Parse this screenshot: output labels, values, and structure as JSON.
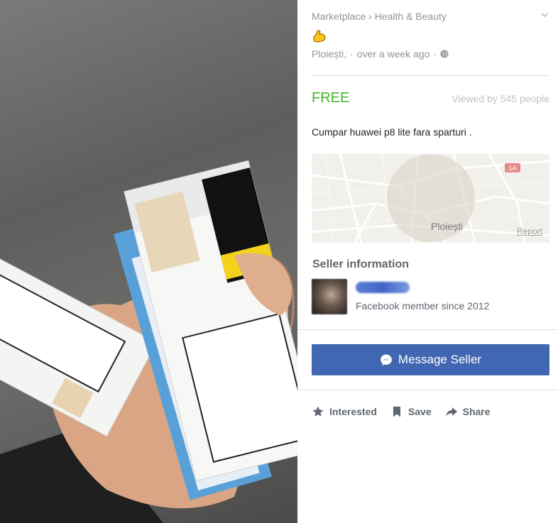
{
  "listing": {
    "breadcrumb": {
      "root": "Marketplace",
      "separator": "›",
      "category": "Health & Beauty"
    },
    "title_icon": "flexed-biceps-emoji",
    "location": "Ploiești,",
    "meta_separator": "·",
    "time_posted": "over a week ago",
    "privacy_icon": "globe-icon",
    "price": "FREE",
    "views": "Viewed by 545 people",
    "description": "Cumpar huawei p8 lite fara sparturi .",
    "map": {
      "city_label": "Ploiești",
      "report_label": "Report",
      "road_badge": "1A"
    }
  },
  "seller": {
    "section_title": "Seller information",
    "member_since": "Facebook member since 2012"
  },
  "actions": {
    "message_label": "Message Seller",
    "interested_label": "Interested",
    "save_label": "Save",
    "share_label": "Share"
  },
  "colors": {
    "price_green": "#42b72a",
    "button_blue": "#4267b2",
    "muted_gray": "#90949c"
  }
}
